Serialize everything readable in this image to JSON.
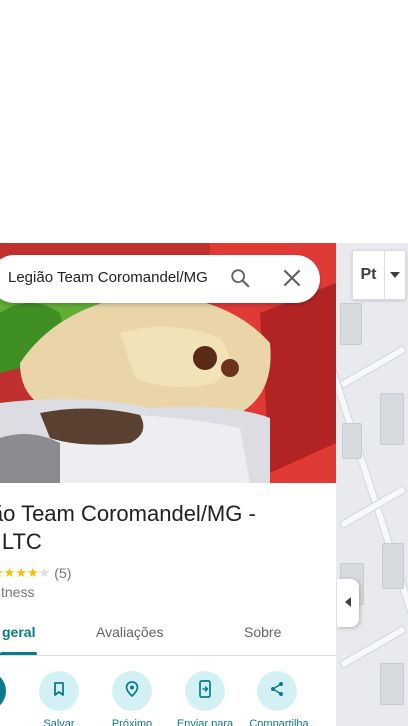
{
  "search": {
    "query": "Legião Team Coromandel/MG"
  },
  "map": {
    "language_button_label": "Pt"
  },
  "place": {
    "title": "ião Team Coromandel/MG - ll LTC",
    "rating_count": "(5)",
    "stars_filled": 4,
    "stars_total": 5,
    "category": "fitness"
  },
  "tabs": [
    {
      "label": "geral",
      "active": true
    },
    {
      "label": "Avaliações",
      "active": false
    },
    {
      "label": "Sobre",
      "active": false
    }
  ],
  "actions": [
    {
      "label": "",
      "icon": "directions-icon"
    },
    {
      "label": "Salvar",
      "icon": "bookmark-icon"
    },
    {
      "label": "Próximo",
      "icon": "nearby-icon"
    },
    {
      "label": "Enviar para",
      "icon": "send-to-phone-icon"
    },
    {
      "label": "Compartilha",
      "icon": "share-icon"
    }
  ],
  "colors": {
    "accent": "#0b7a89",
    "action_bg": "#d3f1f4",
    "star": "#fbbc04",
    "text_secondary": "#70757a"
  }
}
